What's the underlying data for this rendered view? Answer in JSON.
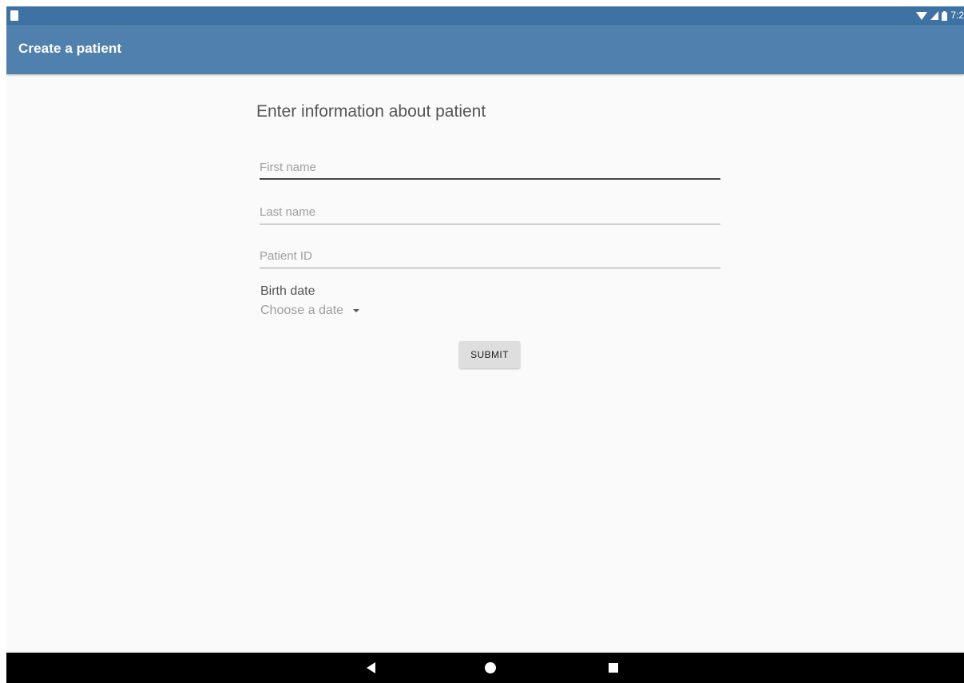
{
  "status_bar": {
    "left_icon": "sd-card-icon",
    "wifi_icon": "wifi-icon",
    "signal_icon": "cell-signal-icon",
    "battery_icon": "battery-icon",
    "time": "7:2"
  },
  "toolbar": {
    "title": "Create a patient"
  },
  "form": {
    "heading": "Enter information about patient",
    "first_name_placeholder": "First name",
    "last_name_placeholder": "Last name",
    "patient_id_placeholder": "Patient ID",
    "birth_date_label": "Birth date",
    "birth_date_value": "Choose a date",
    "dropdown_icon": "dropdown-arrow-icon",
    "submit_label": "SUBMIT"
  },
  "nav_bar": {
    "back_icon": "back-triangle-icon",
    "home_icon": "home-circle-icon",
    "recents_icon": "recents-square-icon"
  },
  "colors": {
    "status_bar": "#3f72a4",
    "toolbar": "#5081ae",
    "background": "#fafafa",
    "button": "#dedede"
  }
}
